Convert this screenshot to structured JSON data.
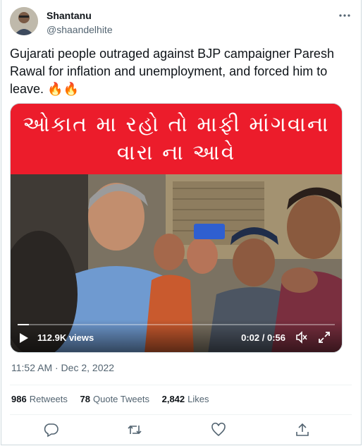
{
  "author": {
    "name": "Shantanu",
    "handle": "@shaandelhite"
  },
  "tweet": {
    "text": "Gujarati people outraged against BJP campaigner Paresh Rawal for inflation and unemployment, and forced him to leave. 🔥🔥",
    "timestamp": "11:52 AM · Dec 2, 2022"
  },
  "video": {
    "banner_line1": "ઓકાત મા રહો તો માફી માંગવાના",
    "banner_line2": "વારા ના આવે",
    "views": "112.9K views",
    "time": "0:02 / 0:56",
    "progress": 0.036,
    "banner_color": "#ec1c2b"
  },
  "stats": {
    "retweets_count": "986",
    "retweets_label": "Retweets",
    "quotes_count": "78",
    "quotes_label": "Quote Tweets",
    "likes_count": "2,842",
    "likes_label": "Likes"
  },
  "icons": [
    "more-icon",
    "play-icon",
    "mute-icon",
    "fullscreen-icon",
    "reply-icon",
    "retweet-icon",
    "like-icon",
    "share-icon"
  ]
}
